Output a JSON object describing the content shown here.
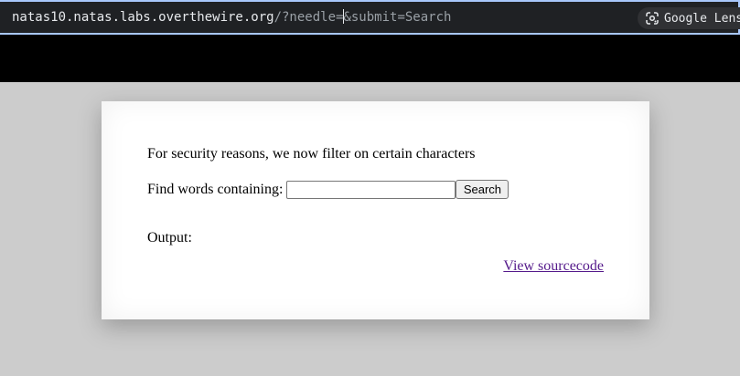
{
  "browser": {
    "url_host": "natas10.natas.labs.overthewire.org",
    "url_path_before_caret": "/?needle=",
    "url_path_after_caret": "&submit=Search",
    "lens_label": "Google Lens",
    "lens_icon": "google-lens-icon"
  },
  "page": {
    "notice": "For security reasons, we now filter on certain characters",
    "find_label": "Find words containing:",
    "needle_value": "",
    "search_button": "Search",
    "output_label": "Output:",
    "view_source_link": "View sourcecode"
  },
  "colors": {
    "page_bg": "#cccccc",
    "link_visited": "#551a8b",
    "urlbar_bg": "#1f2124",
    "urlbar_focus": "#a8c7fa"
  }
}
